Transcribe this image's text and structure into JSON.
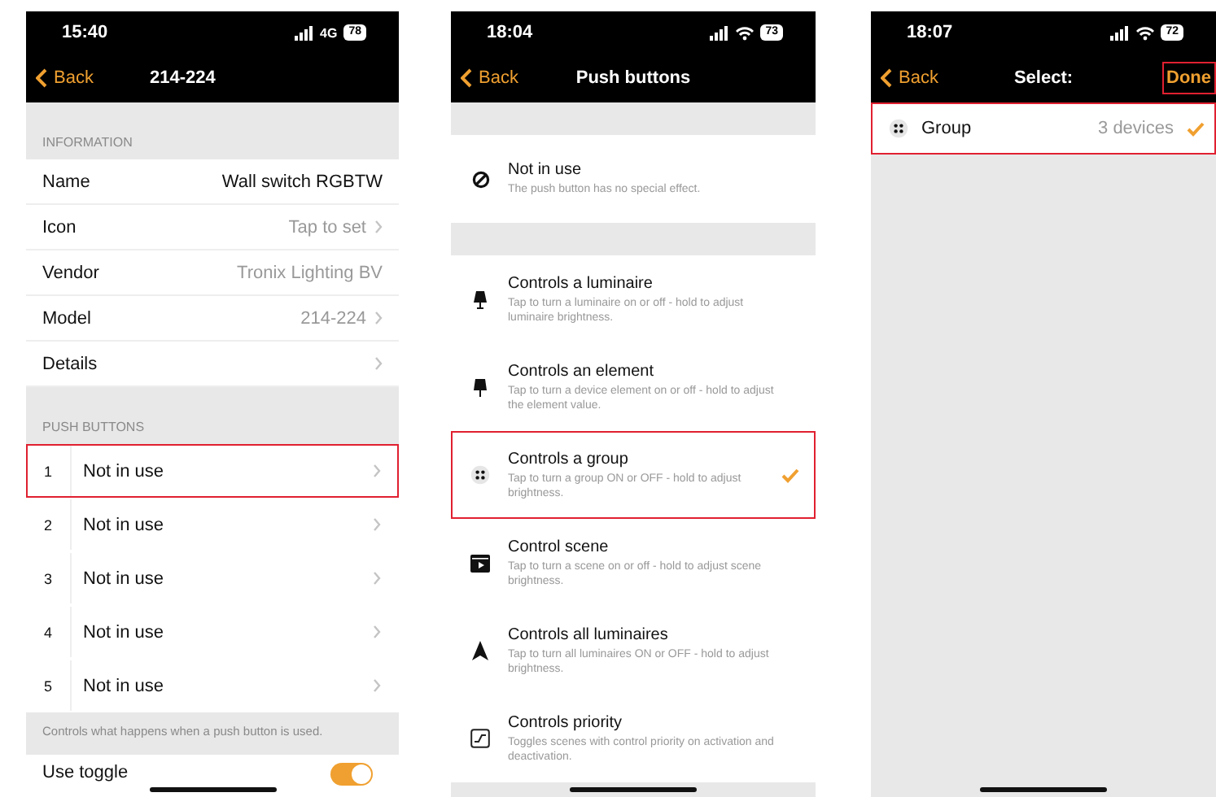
{
  "device_screen": {
    "status_bar": {
      "time": "15:40",
      "network": "4G",
      "battery": "78"
    },
    "nav": {
      "back": "Back",
      "title": "214-224"
    },
    "information": {
      "header": "INFORMATION",
      "rows": [
        {
          "label": "Name",
          "value": "Wall switch RGBTW",
          "secondary": false,
          "chevron": false
        },
        {
          "label": "Icon",
          "value": "Tap to set",
          "secondary": true,
          "chevron": true
        },
        {
          "label": "Vendor",
          "value": "Tronix Lighting BV",
          "secondary": true,
          "chevron": false
        },
        {
          "label": "Model",
          "value": "214-224",
          "secondary": true,
          "chevron": true
        },
        {
          "label": "Details",
          "chevron": true
        }
      ]
    },
    "push_buttons": {
      "header": "PUSH BUTTONS",
      "rows": [
        {
          "number": "1",
          "label": "Not in use",
          "highlighted": true
        },
        {
          "number": "2",
          "label": "Not in use",
          "highlighted": false
        },
        {
          "number": "3",
          "label": "Not in use",
          "highlighted": false
        },
        {
          "number": "4",
          "label": "Not in use",
          "highlighted": false
        },
        {
          "number": "5",
          "label": "Not in use",
          "highlighted": false
        }
      ],
      "footer": "Controls what happens when a push button is used."
    },
    "toggle": {
      "label": "Use toggle",
      "on": true
    }
  },
  "push_buttons_screen": {
    "status_bar": {
      "time": "18:04",
      "battery": "73"
    },
    "nav": {
      "back": "Back",
      "title": "Push buttons"
    },
    "sections": [
      {
        "options": [
          {
            "kind": "none",
            "title": "Not in use",
            "description": "The push button has no special effect.",
            "selected": false,
            "highlighted": false
          }
        ]
      },
      {
        "options": [
          {
            "kind": "luminaire",
            "title": "Controls a luminaire",
            "description": "Tap to turn a luminaire on or off - hold to adjust luminaire brightness.",
            "selected": false,
            "highlighted": false
          },
          {
            "kind": "element",
            "title": "Controls an element",
            "description": "Tap to turn a device element on or off - hold to adjust the element value.",
            "selected": false,
            "highlighted": false
          },
          {
            "kind": "group",
            "title": "Controls a group",
            "description": "Tap to turn a group ON or OFF - hold to adjust brightness.",
            "selected": true,
            "highlighted": true
          },
          {
            "kind": "scene",
            "title": "Control scene",
            "description": "Tap to turn a scene on or off - hold to adjust scene brightness.",
            "selected": false,
            "highlighted": false
          },
          {
            "kind": "all",
            "title": "Controls all luminaires",
            "description": "Tap to turn all luminaires ON or OFF - hold to adjust brightness.",
            "selected": false,
            "highlighted": false
          },
          {
            "kind": "priority",
            "title": "Controls priority",
            "description": "Toggles scenes with control priority on activation and deactivation.",
            "selected": false,
            "highlighted": false
          }
        ]
      }
    ]
  },
  "select_screen": {
    "status_bar": {
      "time": "18:07",
      "battery": "72"
    },
    "nav": {
      "back": "Back",
      "title": "Select:",
      "action": "Done",
      "action_highlighted": true
    },
    "rows": [
      {
        "label": "Group",
        "detail": "3 devices",
        "selected": true,
        "highlighted": true
      }
    ]
  }
}
